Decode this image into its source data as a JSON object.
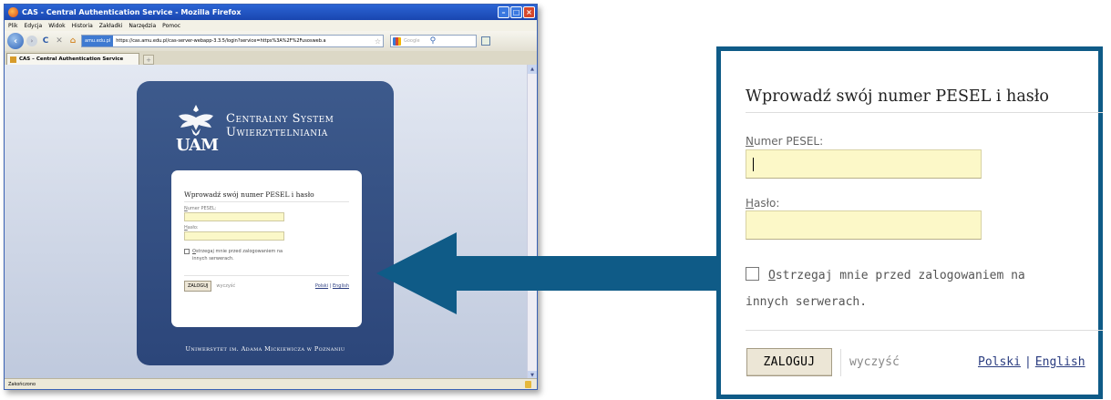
{
  "browser": {
    "title": "CAS - Central Authentication Service - Mozilla Firefox",
    "menu": [
      "Plik",
      "Edycja",
      "Widok",
      "Historia",
      "Zakładki",
      "Narzędzia",
      "Pomoc"
    ],
    "site_badge": "amu.edu.pl",
    "url": "https://cas.amu.edu.pl/cas-server-webapp-3.3.5/login?service=https%3A%2F%2Fusosweb.a",
    "search_placeholder": "Google",
    "tab_label": "CAS – Central Authentication Service",
    "status": "Zakończono"
  },
  "cas": {
    "logo_text": "UAM",
    "system_title_line1": "Centralny System",
    "system_title_line2": "Uwierzytelniania",
    "footer": "Uniwersytet im. Adama Mickiewicza w Poznaniu"
  },
  "login": {
    "heading": "Wprowadź swój numer PESEL i hasło",
    "pesel_label_first": "N",
    "pesel_label_rest": "umer PESEL:",
    "password_label_first": "H",
    "password_label_rest": "asło:",
    "warn_first": "O",
    "warn_rest": "strzegaj mnie przed zalogowaniem na",
    "warn_line2": "innych serwerach.",
    "login_button": "ZALOGUJ",
    "clear_label": "wyczyść",
    "lang_polish": "Polski",
    "lang_separator": "|",
    "lang_english": "English"
  },
  "colors": {
    "panel_border": "#0f5b87",
    "arrow": "#0f5b87",
    "cas_panel": "#2f4a7d",
    "input_bg": "#fcf8c8",
    "link": "#2b3d80"
  },
  "icons": [
    "firefox-icon",
    "back-icon",
    "forward-icon",
    "reload-icon",
    "stop-icon",
    "home-icon",
    "star-icon",
    "search-icon",
    "lock-icon"
  ]
}
